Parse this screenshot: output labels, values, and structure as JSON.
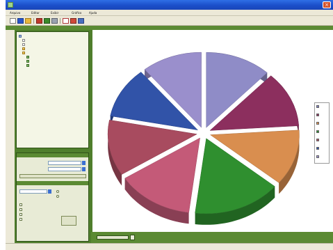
{
  "window": {
    "title": ""
  },
  "menu": {
    "items": [
      "Arquivo",
      "Editar",
      "Exibir",
      "Gráfico",
      "Ajuda"
    ]
  },
  "toolbar": {
    "icons": [
      "new-icon",
      "open-icon",
      "save-icon",
      "print-icon",
      "chart-icon",
      "copy-icon",
      "export-icon",
      "image-icon",
      "properties-icon"
    ]
  },
  "tree": {
    "nodes": [
      "",
      "",
      "",
      "",
      "",
      "",
      "",
      ""
    ]
  },
  "controls": {
    "section1_caption": "",
    "section2_caption": "",
    "button_label": ""
  },
  "chart": {
    "title": ""
  },
  "zoom": {
    "label": ""
  },
  "status": {
    "left": "",
    "right": ""
  },
  "chart_data": {
    "type": "pie",
    "title": "",
    "style": "3d-exploded",
    "slices": [
      {
        "value": 12,
        "color": "#8f8cc7"
      },
      {
        "value": 12,
        "color": "#8c2f5e"
      },
      {
        "value": 12,
        "color": "#d98e4f"
      },
      {
        "value": 16,
        "color": "#2f8f2f"
      },
      {
        "value": 14,
        "color": "#c45a78"
      },
      {
        "value": 12,
        "color": "#a84b5f"
      },
      {
        "value": 11,
        "color": "#3153a8"
      },
      {
        "value": 11,
        "color": "#9a8fcc"
      }
    ],
    "legend": {
      "position": "right",
      "entries": [
        "",
        "",
        "",
        "",
        "",
        "",
        ""
      ],
      "colors": [
        "#7f7fbf",
        "#8c2f5e",
        "#d98e4f",
        "#2f8f2f",
        "#a84b5f",
        "#3153a8",
        "#9a8fcc"
      ]
    }
  }
}
